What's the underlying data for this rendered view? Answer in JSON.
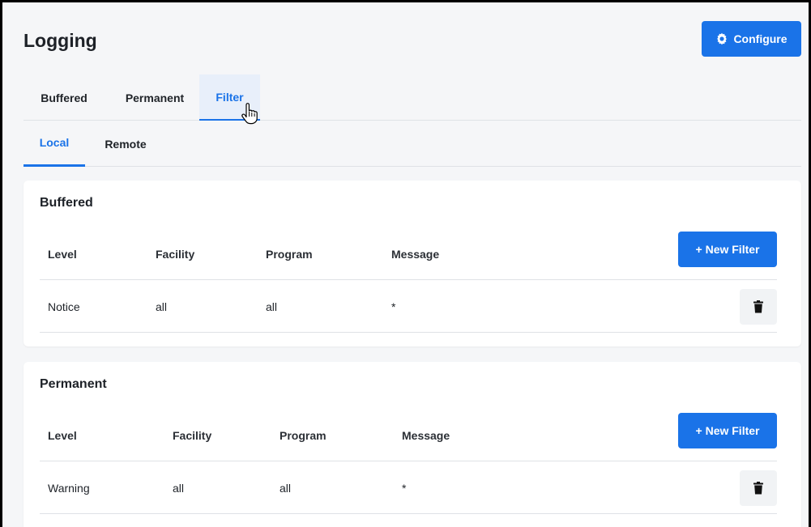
{
  "header": {
    "title": "Logging",
    "configure_label": "Configure"
  },
  "tabs": [
    {
      "label": "Buffered",
      "active": false
    },
    {
      "label": "Permanent",
      "active": false
    },
    {
      "label": "Filter",
      "active": true
    }
  ],
  "subtabs": [
    {
      "label": "Local",
      "active": true
    },
    {
      "label": "Remote",
      "active": false
    }
  ],
  "sections": [
    {
      "title": "Buffered",
      "columns": [
        "Level",
        "Facility",
        "Program",
        "Message"
      ],
      "new_filter_label": "+ New Filter",
      "rows": [
        {
          "level": "Notice",
          "facility": "all",
          "program": "all",
          "message": "*"
        }
      ]
    },
    {
      "title": "Permanent",
      "columns": [
        "Level",
        "Facility",
        "Program",
        "Message"
      ],
      "new_filter_label": "+ New Filter",
      "rows": [
        {
          "level": "Warning",
          "facility": "all",
          "program": "all",
          "message": "*"
        }
      ]
    }
  ],
  "colors": {
    "accent": "#1a73e8",
    "background": "#f5f6f8",
    "card": "#ffffff"
  },
  "icons": {
    "configure": "gear-icon",
    "delete": "trash-icon",
    "cursor": "hand-pointer-icon"
  }
}
